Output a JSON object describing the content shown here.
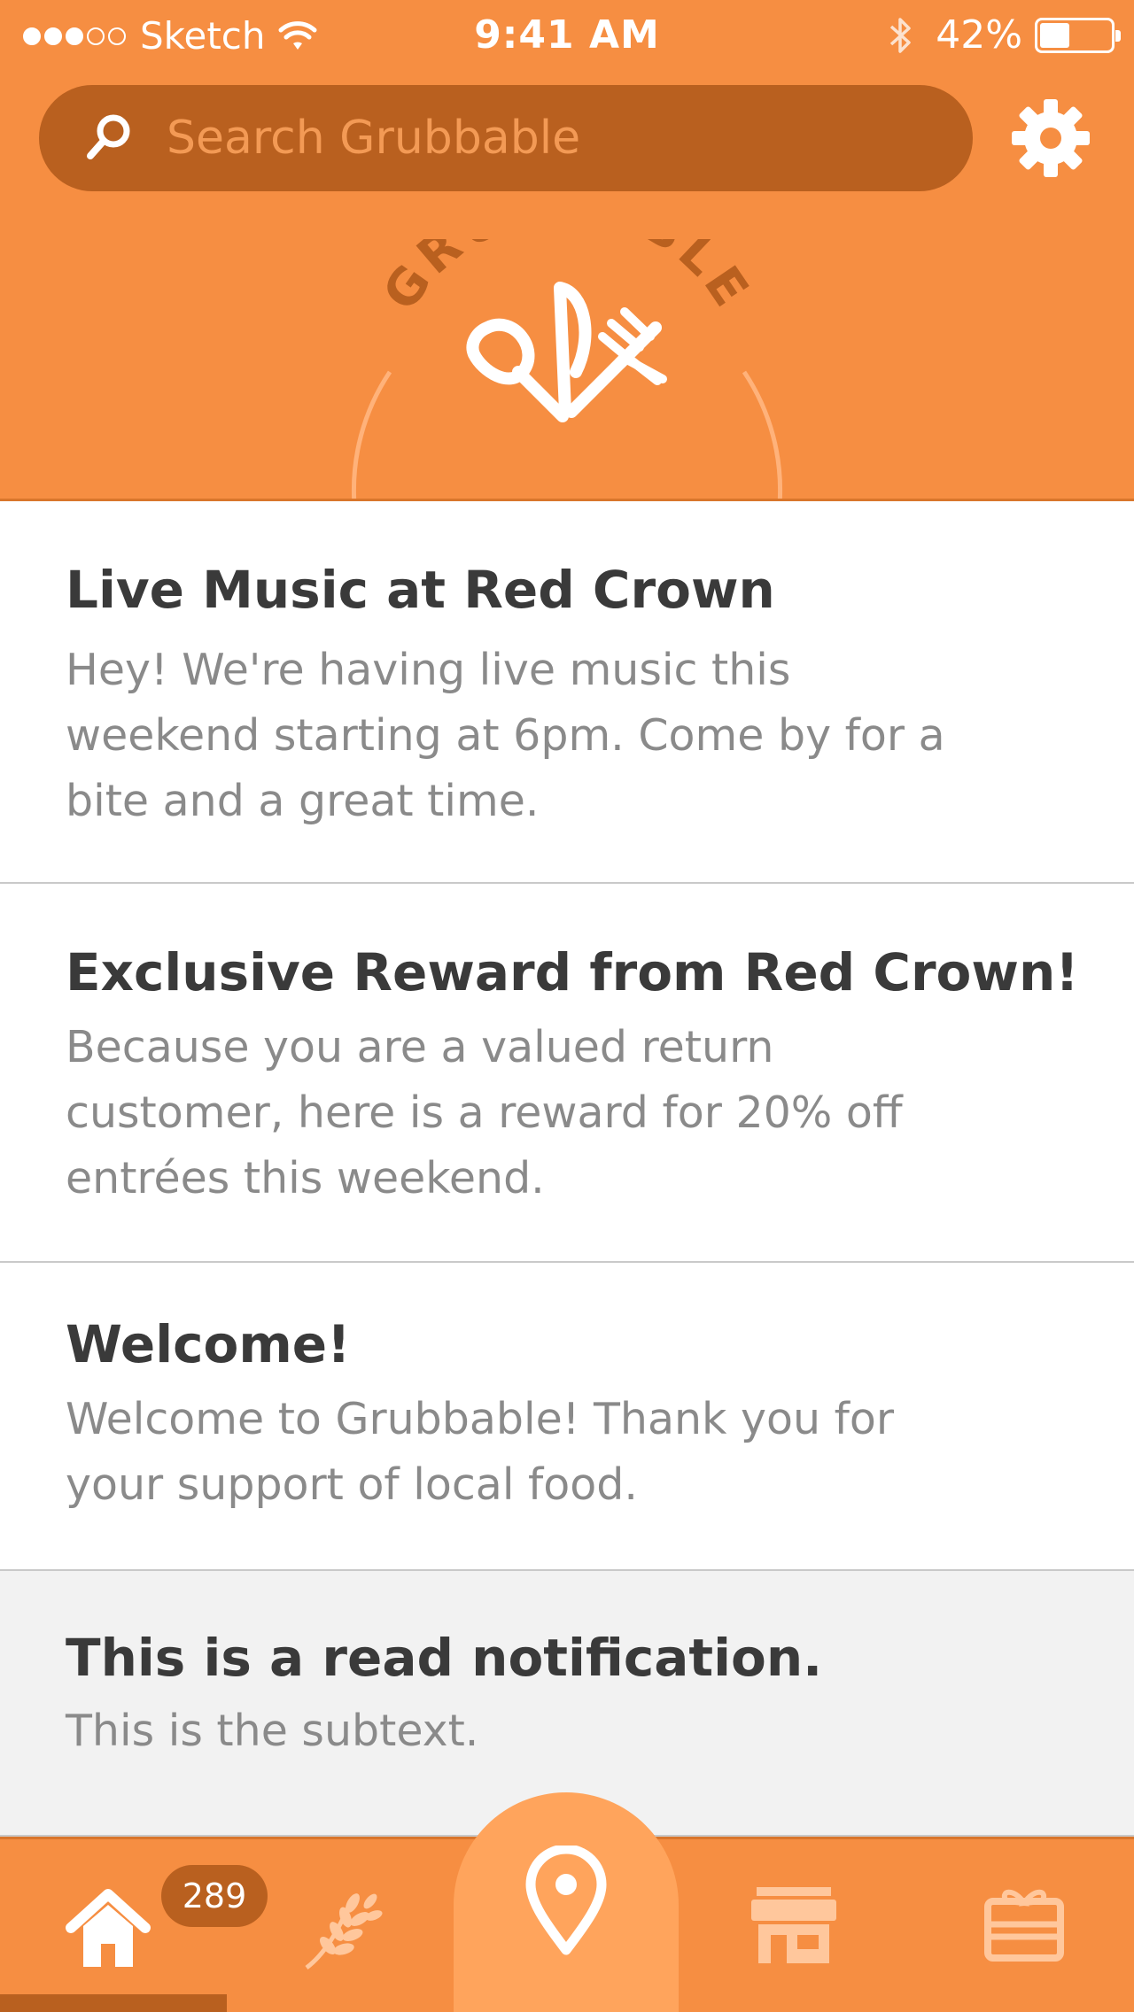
{
  "status_bar": {
    "carrier": "Sketch",
    "time": "9:41 AM",
    "battery_percent": "42%",
    "battery_level": 0.42
  },
  "search": {
    "placeholder": "Search Grubbable"
  },
  "logo": {
    "wordmark": "GRUBBABLE"
  },
  "notifications": [
    {
      "title": "Live Music at Red Crown",
      "lines": [
        "Hey! We're having live music this",
        "weekend starting at 6pm. Come by for a",
        "bite and a great time."
      ],
      "read": false
    },
    {
      "title": "Exclusive Reward from Red Crown!",
      "lines": [
        "Because you are a valued return",
        "customer, here is a reward for 20% off",
        "entrées this weekend."
      ],
      "read": false
    },
    {
      "title": "Welcome!",
      "lines": [
        "Welcome to Grubbable! Thank you for",
        "your support of local food."
      ],
      "read": false
    },
    {
      "title": "This is a read notification.",
      "lines": [
        "This is the subtext."
      ],
      "read": true
    }
  ],
  "tabbar": {
    "home_badge": "289",
    "tabs": [
      "home-icon",
      "wheat-icon",
      "location-pin-icon",
      "store-icon",
      "gift-card-icon"
    ]
  },
  "colors": {
    "brand_orange": "#F68E42",
    "brand_dark": "#B9601F",
    "center_tab": "#FFA45C",
    "title_text": "#3A3A3A",
    "body_text": "#8A8A8A"
  }
}
